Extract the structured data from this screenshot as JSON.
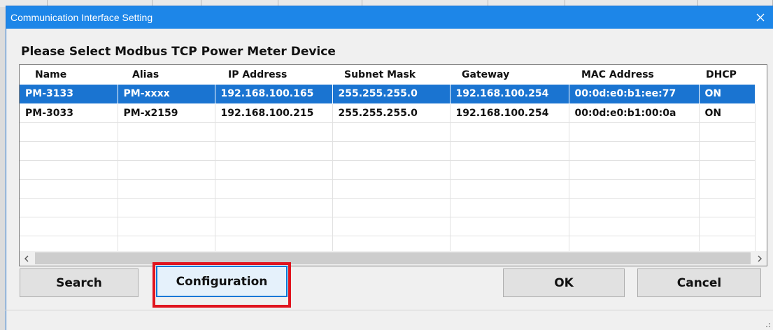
{
  "dialog": {
    "title": "Communication Interface Setting",
    "heading": "Please Select Modbus TCP Power Meter Device"
  },
  "table": {
    "columns": [
      "Name",
      "Alias",
      "IP Address",
      "Subnet Mask",
      "Gateway",
      "MAC Address",
      "DHCP"
    ],
    "rows": [
      [
        "PM-3133",
        "PM-xxxx",
        "192.168.100.165",
        "255.255.255.0",
        "192.168.100.254",
        "00:0d:e0:b1:ee:77",
        "ON"
      ],
      [
        "PM-3033",
        "PM-x2159",
        "192.168.100.215",
        "255.255.255.0",
        "192.168.100.254",
        "00:0d:e0:b1:00:0a",
        "ON"
      ]
    ],
    "selected_row": 0
  },
  "buttons": {
    "search": "Search",
    "configuration": "Configuration",
    "ok": "OK",
    "cancel": "Cancel"
  },
  "icons": {
    "close": "close-icon",
    "scroll_left": "chevron-left-icon",
    "scroll_right": "chevron-right-icon",
    "resize_grip": "resize-grip-icon"
  },
  "colors": {
    "titlebar": "#1d86e8",
    "selection": "#1a74d1",
    "highlight": "#e0141e"
  }
}
